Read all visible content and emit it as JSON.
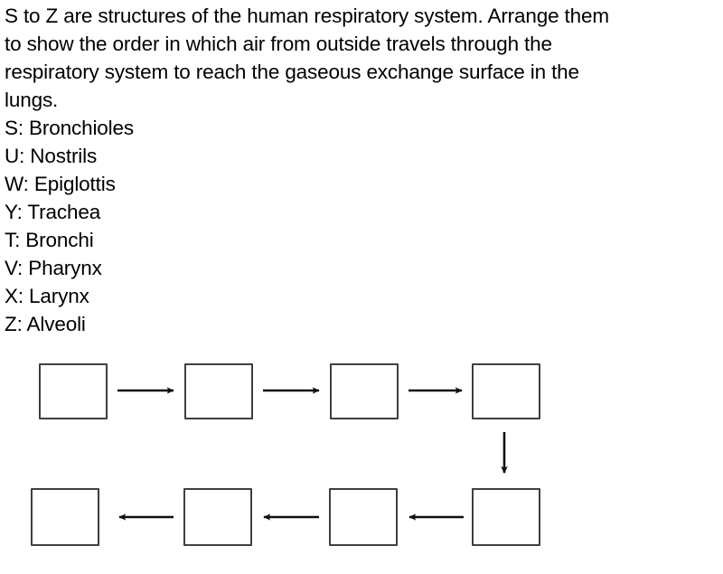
{
  "question": {
    "lines": [
      "S to Z are structures of the human respiratory system. Arrange them",
      "to show the order in which air from outside travels through the",
      "respiratory system to reach the gaseous exchange surface in the",
      "lungs."
    ]
  },
  "structure_key": {
    "items": [
      {
        "label": "S",
        "name": "Bronchioles",
        "line": "S: Bronchioles"
      },
      {
        "label": "U",
        "name": "Nostrils",
        "line": "U: Nostrils"
      },
      {
        "label": "W",
        "name": "Epiglottis",
        "line": "W: Epiglottis"
      },
      {
        "label": "Y",
        "name": "Trachea",
        "line": "Y: Trachea"
      },
      {
        "label": "T",
        "name": "Bronchi",
        "line": "T: Bronchi"
      },
      {
        "label": "V",
        "name": "Pharynx",
        "line": "V: Pharynx"
      },
      {
        "label": "X",
        "name": "Larynx",
        "line": "X: Larynx"
      },
      {
        "label": "Z",
        "name": "Alveoli",
        "line": "Z: Alveoli"
      }
    ]
  },
  "diagram": {
    "row1": {
      "boxes": [
        {
          "id": "box-1",
          "value": ""
        },
        {
          "id": "box-2",
          "value": ""
        },
        {
          "id": "box-3",
          "value": ""
        },
        {
          "id": "box-4",
          "value": ""
        }
      ],
      "arrow_direction": "right"
    },
    "connector": {
      "arrow_direction": "down"
    },
    "row2": {
      "boxes": [
        {
          "id": "box-8",
          "value": ""
        },
        {
          "id": "box-7",
          "value": ""
        },
        {
          "id": "box-6",
          "value": ""
        },
        {
          "id": "box-5",
          "value": ""
        }
      ],
      "arrow_direction": "left"
    }
  },
  "colors": {
    "background": "#ffffff",
    "text": "#000000",
    "box_border": "#3a3a42",
    "arrow": "#101014"
  }
}
